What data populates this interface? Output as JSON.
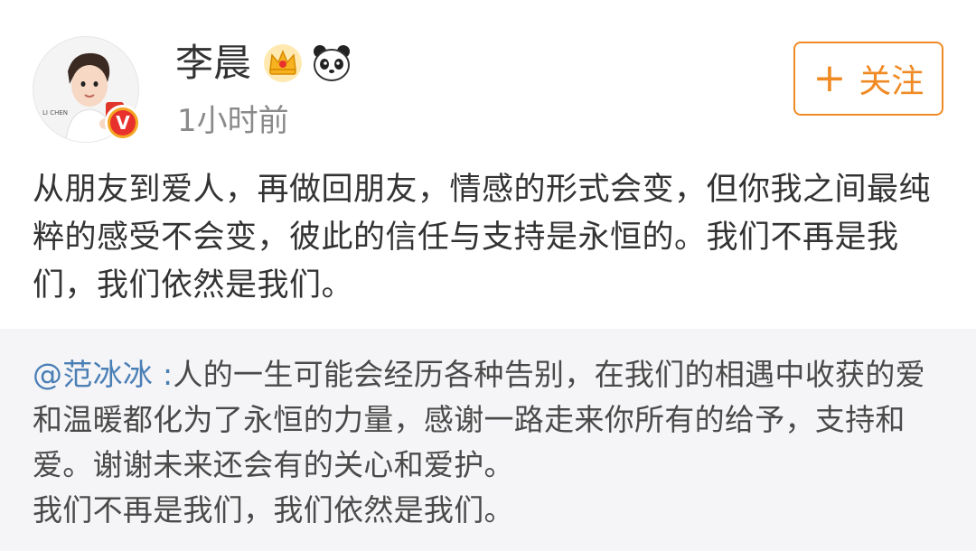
{
  "user": {
    "name": "李晨",
    "time": "1小时前",
    "avatar_caption": "LI CHEN",
    "verified_mark": "V",
    "badges": [
      "crown-icon",
      "panda-icon"
    ]
  },
  "follow_button": {
    "plus": "+",
    "label": "关注"
  },
  "post": {
    "text": "从朋友到爱人，再做回朋友，情感的形式会变，但你我之间最纯粹的感受不会变，彼此的信任与支持是永恒的。我们不再是我们，我们依然是我们。"
  },
  "repost": {
    "mention": "@范冰冰",
    "separator": " :",
    "text": "人的一生可能会经历各种告别，在我们的相遇中收获的爱和温暖都化为了永恒的力量，感谢一路走来你所有的给予，支持和爱。谢谢未来还会有的关心和爱护。",
    "text2": "我们不再是我们，我们依然是我们。"
  },
  "colors": {
    "accent": "#f08a24",
    "mention": "#4a7fb6",
    "repost_bg": "#f5f5f7",
    "timestamp": "#8a8a8a"
  }
}
